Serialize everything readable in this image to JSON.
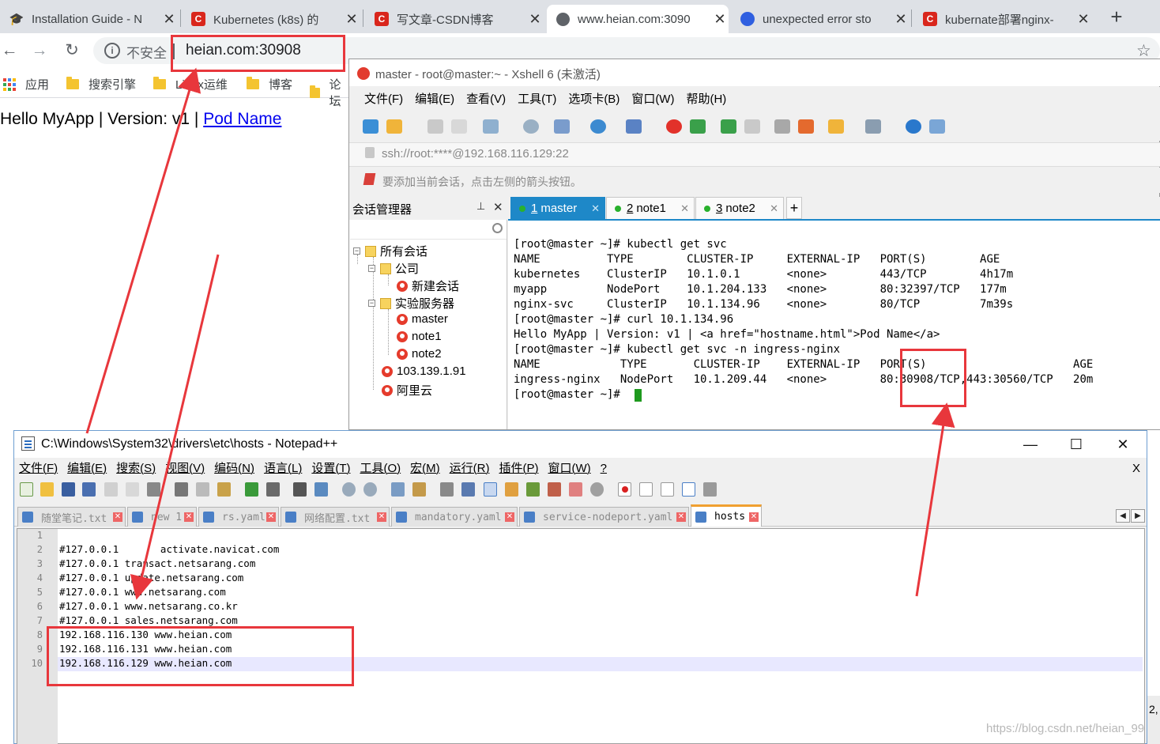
{
  "browser": {
    "tabs": [
      {
        "title": "Installation Guide - N",
        "icon": "graduation-cap-icon"
      },
      {
        "title": "Kubernetes (k8s) 的",
        "icon": "csdn-icon"
      },
      {
        "title": "写文章-CSDN博客",
        "icon": "csdn-icon"
      },
      {
        "title": "www.heian.com:3090",
        "icon": "globe-icon"
      },
      {
        "title": "unexpected error sto",
        "icon": "baidu-paw-icon"
      },
      {
        "title": "kubernate部署nginx-",
        "icon": "csdn-icon"
      }
    ],
    "new_tab_label": "+",
    "close_glyph": "✕",
    "address": {
      "security_label": "不安全",
      "url": "heian.com:30908"
    },
    "bookmarks": [
      "应用",
      "搜索引擎",
      "Linux运维",
      "博客",
      "论坛"
    ],
    "page": {
      "text": "Hello MyApp | Version: v1 | ",
      "link": "Pod Name"
    }
  },
  "xshell": {
    "title": "master - root@master:~ - Xshell 6 (未激活)",
    "menu": [
      "文件(F)",
      "编辑(E)",
      "查看(V)",
      "工具(T)",
      "选项卡(B)",
      "窗口(W)",
      "帮助(H)"
    ],
    "address": "ssh://root:****@192.168.116.129:22",
    "hint": "要添加当前会话，点击左侧的箭头按钮。",
    "session_manager": {
      "title": "会话管理器",
      "pin": "𝟖",
      "close": "✕",
      "tree": [
        {
          "label": "所有会话",
          "kind": "folder"
        },
        {
          "label": "公司",
          "kind": "folder"
        },
        {
          "label": "新建会话",
          "kind": "session"
        },
        {
          "label": "实验服务器",
          "kind": "folder"
        },
        {
          "label": "master",
          "kind": "session"
        },
        {
          "label": "note1",
          "kind": "session"
        },
        {
          "label": "note2",
          "kind": "session"
        },
        {
          "label": "103.139.1.91",
          "kind": "session"
        },
        {
          "label": "阿里云",
          "kind": "session"
        }
      ]
    },
    "tabs": [
      {
        "num": "1",
        "name": "master"
      },
      {
        "num": "2",
        "name": "note1"
      },
      {
        "num": "3",
        "name": "note2"
      }
    ],
    "terminal": [
      "[root@master ~]# kubectl get svc",
      "NAME          TYPE        CLUSTER-IP     EXTERNAL-IP   PORT(S)        AGE",
      "kubernetes    ClusterIP   10.1.0.1       <none>        443/TCP        4h17m",
      "myapp         NodePort    10.1.204.133   <none>        80:32397/TCP   177m",
      "nginx-svc     ClusterIP   10.1.134.96    <none>        80/TCP         7m39s",
      "[root@master ~]# curl 10.1.134.96",
      "Hello MyApp | Version: v1 | <a href=\"hostname.html\">Pod Name</a>",
      "[root@master ~]# kubectl get svc -n ingress-nginx",
      "NAME            TYPE       CLUSTER-IP    EXTERNAL-IP   PORT(S)                      AGE",
      "ingress-nginx   NodePort   10.1.209.44   <none>        80:30908/TCP,443:30560/TCP   20m",
      "[root@master ~]# "
    ]
  },
  "notepad": {
    "title": "C:\\Windows\\System32\\drivers\\etc\\hosts - Notepad++",
    "window_buttons": {
      "min": "—",
      "max": "☐",
      "close": "✕"
    },
    "menu": [
      "文件(F)",
      "编辑(E)",
      "搜索(S)",
      "视图(V)",
      "编码(N)",
      "语言(L)",
      "设置(T)",
      "工具(O)",
      "宏(M)",
      "运行(R)",
      "插件(P)",
      "窗口(W)",
      "?"
    ],
    "menu_close": "X",
    "tabs": [
      "随堂笔记.txt",
      "new 1",
      "rs.yaml",
      "网络配置.txt",
      "mandatory.yaml",
      "service-nodeport.yaml",
      "hosts"
    ],
    "lines": [
      {
        "n": "1",
        "text": ""
      },
      {
        "n": "2",
        "text": "#127.0.0.1       activate.navicat.com"
      },
      {
        "n": "3",
        "text": "#127.0.0.1 transact.netsarang.com"
      },
      {
        "n": "4",
        "text": "#127.0.0.1 update.netsarang.com"
      },
      {
        "n": "5",
        "text": "#127.0.0.1 www.netsarang.com"
      },
      {
        "n": "6",
        "text": "#127.0.0.1 www.netsarang.co.kr"
      },
      {
        "n": "7",
        "text": "#127.0.0.1 sales.netsarang.com"
      },
      {
        "n": "8",
        "text": "192.168.116.130 www.heian.com"
      },
      {
        "n": "9",
        "text": "192.168.116.131 www.heian.com"
      },
      {
        "n": "10",
        "text": "192.168.116.129 www.heian.com"
      }
    ],
    "status_peek": "2,",
    "watermark": "https://blog.csdn.net/heian_99"
  },
  "colors": {
    "annotation": "#e8373c",
    "xshell_accent": "#1e88c8",
    "link": "#0000ee"
  }
}
